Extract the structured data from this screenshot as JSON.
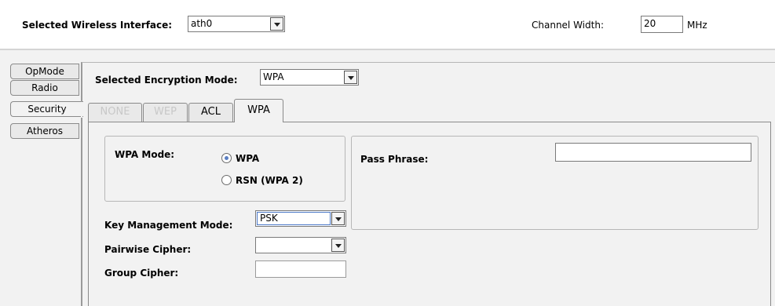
{
  "header": {
    "interface_label": "Selected Wireless Interface:",
    "interface_value": "ath0",
    "channel_width_label": "Channel Width:",
    "channel_width_value": "20",
    "channel_width_unit": "MHz"
  },
  "side_tabs": [
    {
      "label": "OpMode",
      "active": false
    },
    {
      "label": "Radio",
      "active": false
    },
    {
      "label": "Security",
      "active": true
    },
    {
      "label": "Atheros",
      "active": false
    }
  ],
  "encryption": {
    "label": "Selected Encryption Mode:",
    "value": "WPA"
  },
  "enc_tabs": [
    {
      "label": "NONE",
      "state": "disabled"
    },
    {
      "label": "WEP",
      "state": "disabled"
    },
    {
      "label": "ACL",
      "state": "normal"
    },
    {
      "label": "WPA",
      "state": "active"
    }
  ],
  "wpa": {
    "mode_label": "WPA Mode:",
    "mode_options": [
      {
        "label": "WPA",
        "checked": true
      },
      {
        "label": "RSN (WPA 2)",
        "checked": false
      }
    ],
    "pass_phrase_label": "Pass Phrase:",
    "pass_phrase_value": "",
    "key_mgmt_label": "Key Management Mode:",
    "key_mgmt_value": "PSK",
    "pairwise_label": "Pairwise Cipher:",
    "pairwise_value": "",
    "group_label": "Group Cipher:",
    "group_value": ""
  }
}
